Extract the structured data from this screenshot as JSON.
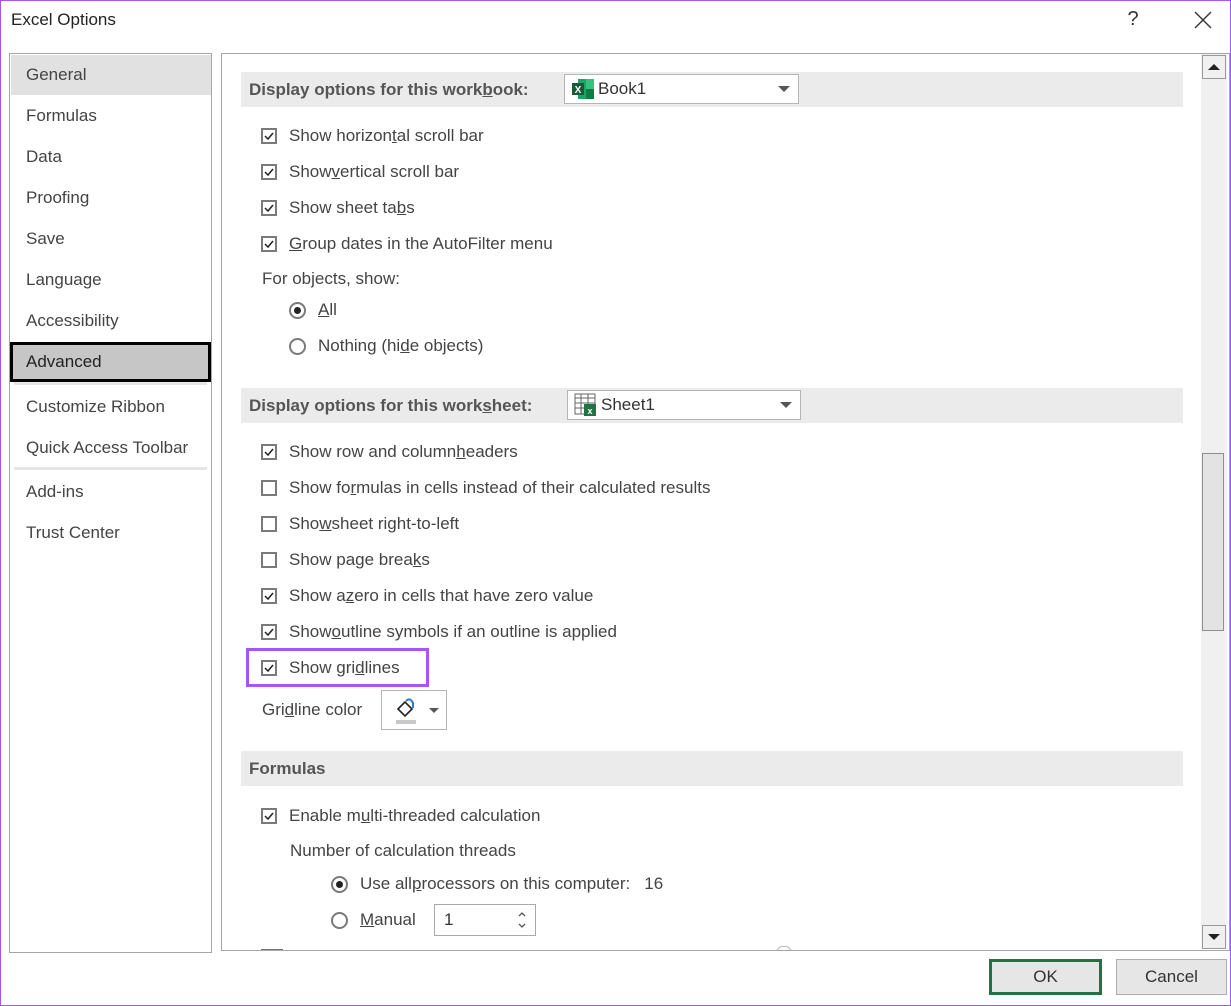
{
  "window": {
    "title": "Excel Options",
    "help_label": "?",
    "close_icon": "close-icon",
    "accent_highlight": "#a855f7",
    "default_button_border": "#217346"
  },
  "sidebar": {
    "items": [
      {
        "label": "General",
        "state": "hover"
      },
      {
        "label": "Formulas"
      },
      {
        "label": "Data"
      },
      {
        "label": "Proofing"
      },
      {
        "label": "Save"
      },
      {
        "label": "Language"
      },
      {
        "label": "Accessibility"
      },
      {
        "label": "Advanced",
        "state": "selected"
      },
      {
        "label": "Customize Ribbon"
      },
      {
        "label": "Quick Access Toolbar"
      },
      {
        "label": "Add-ins"
      },
      {
        "label": "Trust Center"
      }
    ]
  },
  "workbook_section": {
    "header": {
      "pre": "Display options for this work",
      "u": "b",
      "post": "ook:"
    },
    "workbook_select": {
      "value": "Book1",
      "icon": "excel-workbook-icon"
    },
    "options": [
      {
        "pre": "Show horizon",
        "u": "t",
        "post": "al scroll bar",
        "checked": true
      },
      {
        "pre": "Show ",
        "u": "v",
        "post": "ertical scroll bar",
        "checked": true
      },
      {
        "pre": "Show sheet ta",
        "u": "b",
        "post": "s",
        "checked": true
      },
      {
        "pre": "",
        "u": "G",
        "post": "roup dates in the AutoFilter menu",
        "checked": true
      }
    ],
    "objects_label": "For objects, show:",
    "objects_options": [
      {
        "pre": "",
        "u": "A",
        "post": "ll",
        "selected": true
      },
      {
        "pre": "Nothing (hi",
        "u": "d",
        "post": "e objects)",
        "selected": false
      }
    ]
  },
  "worksheet_section": {
    "header": {
      "pre": "Display options for this work",
      "u": "s",
      "post": "heet:"
    },
    "worksheet_select": {
      "value": "Sheet1",
      "icon": "excel-sheet-icon"
    },
    "options": [
      {
        "pre": "Show row and column ",
        "u": "h",
        "post": "eaders",
        "checked": true
      },
      {
        "pre": "Show fo",
        "u": "r",
        "post": "mulas in cells instead of their calculated results",
        "checked": false
      },
      {
        "pre": "Sho",
        "u": "w",
        "post": " sheet right-to-left",
        "checked": false
      },
      {
        "pre": "Show page brea",
        "u": "k",
        "post": "s",
        "checked": false
      },
      {
        "pre": "Show a ",
        "u": "z",
        "post": "ero in cells that have zero value",
        "checked": true
      },
      {
        "pre": "Show ",
        "u": "o",
        "post": "utline symbols if an outline is applied",
        "checked": true
      },
      {
        "pre": "Show gri",
        "u": "d",
        "post": "lines",
        "checked": true,
        "highlighted": true
      }
    ],
    "gridline_color": {
      "pre": "Gri",
      "u": "d",
      "post": "line color",
      "icon": "paint-bucket-icon"
    }
  },
  "formulas_section": {
    "header": "Formulas",
    "multithread": {
      "pre": "Enable m",
      "u": "u",
      "post": "lti-threaded calculation",
      "checked": true
    },
    "threads_label": "Number of calculation threads",
    "use_all": {
      "pre": "Use all ",
      "u": "p",
      "post": "rocessors on this computer:",
      "selected": true,
      "count": "16"
    },
    "manual": {
      "pre": "",
      "u": "M",
      "post": "anual",
      "selected": false,
      "value": "1"
    }
  },
  "scrollbar": {
    "position_fraction": 0.56,
    "visible_fraction": 0.21
  },
  "footer": {
    "ok_label": "OK",
    "cancel_label": "Cancel"
  }
}
